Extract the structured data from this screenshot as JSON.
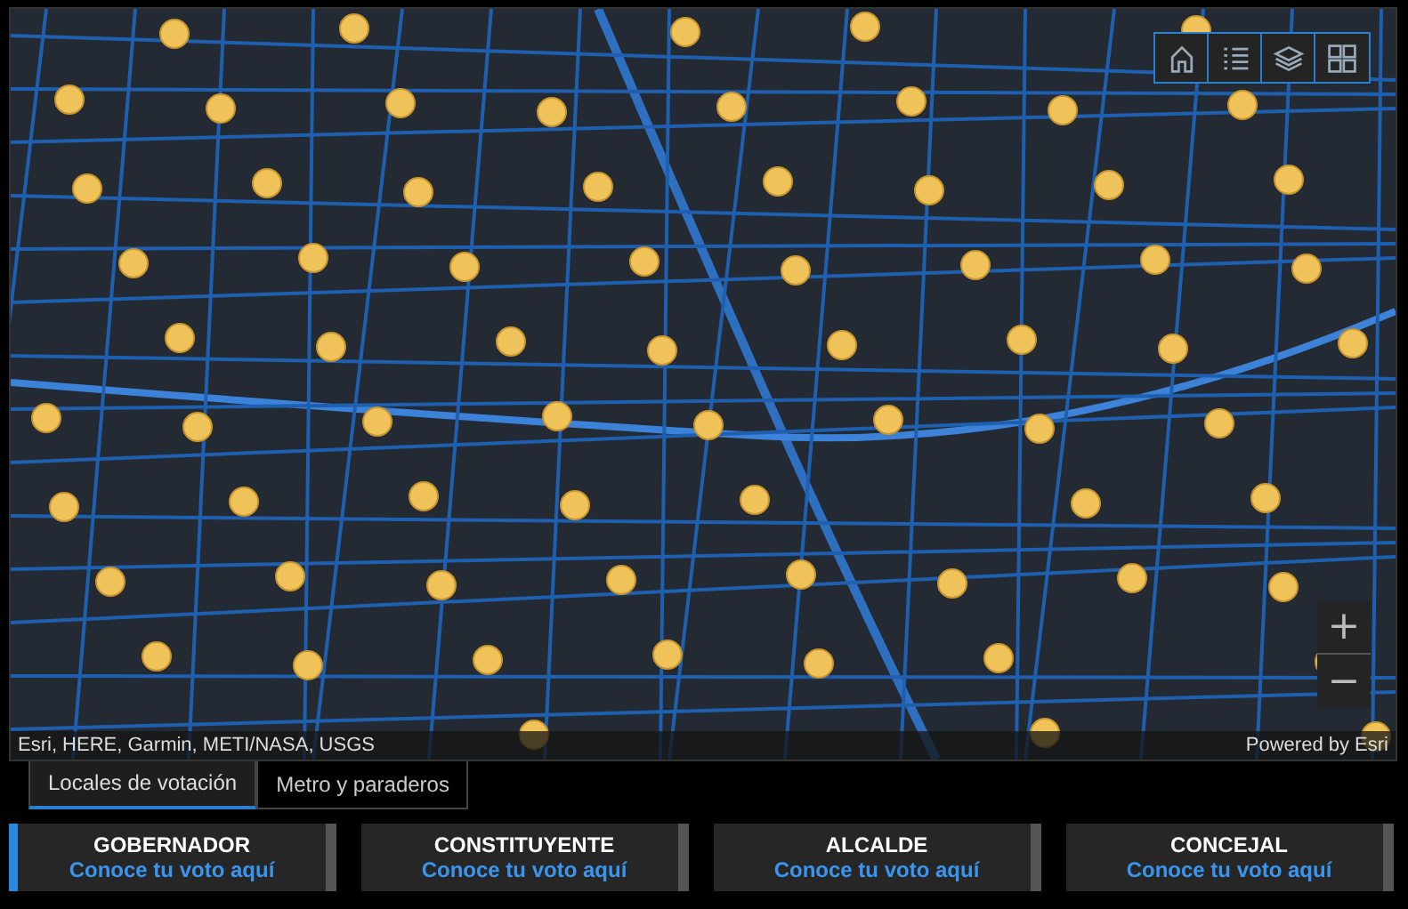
{
  "map": {
    "attribution": "Esri, HERE, Garmin, METI/NASA, USGS",
    "powered_by": "Powered by Esri",
    "zoom_in": "+",
    "zoom_out": "−"
  },
  "tabs": [
    {
      "label": "Locales de votación",
      "selected": true
    },
    {
      "label": "Metro y paraderos",
      "selected": false
    }
  ],
  "cards": [
    {
      "title": "GOBERNADOR",
      "link": "Conoce tu voto aquí",
      "selected": true
    },
    {
      "title": "CONSTITUYENTE",
      "link": "Conoce tu voto aquí",
      "selected": false
    },
    {
      "title": "ALCALDE",
      "link": "Conoce tu voto aquí",
      "selected": false
    },
    {
      "title": "CONCEJAL",
      "link": "Conoce tu voto aquí",
      "selected": false
    }
  ]
}
